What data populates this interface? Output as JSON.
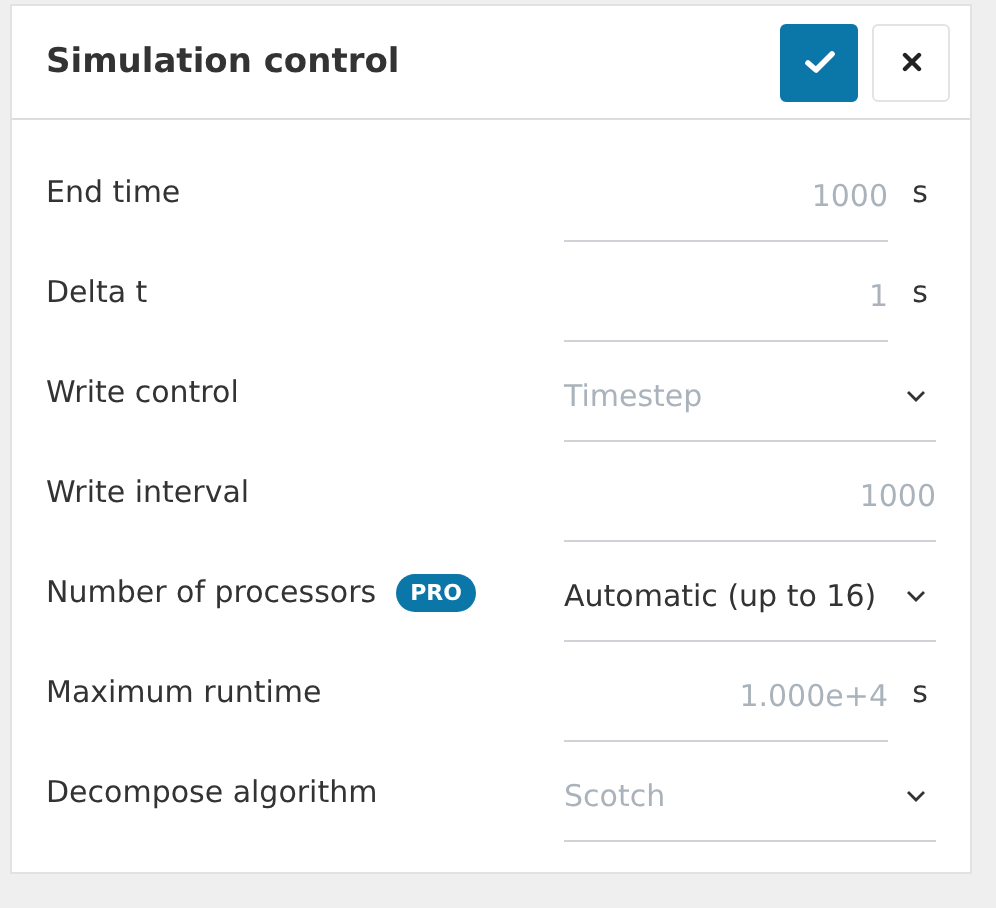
{
  "panel": {
    "title": "Simulation control"
  },
  "fields": [
    {
      "kind": "number",
      "label": "End time",
      "placeholder": "1000",
      "unit": "s"
    },
    {
      "kind": "number",
      "label": "Delta t",
      "placeholder": "1",
      "unit": "s"
    },
    {
      "kind": "select",
      "label": "Write control",
      "placeholder": "Timestep"
    },
    {
      "kind": "number",
      "label": "Write interval",
      "placeholder": "1000"
    },
    {
      "kind": "select",
      "label": "Number of processors",
      "badge": "PRO",
      "value": "Automatic (up to 16)"
    },
    {
      "kind": "number",
      "label": "Maximum runtime",
      "placeholder": "1.000e+4",
      "unit": "s"
    },
    {
      "kind": "select",
      "label": "Decompose algorithm",
      "placeholder": "Scotch"
    }
  ]
}
